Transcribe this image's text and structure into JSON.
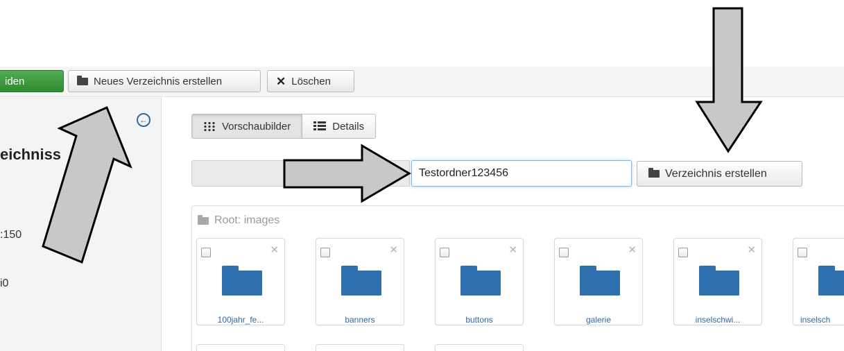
{
  "toolbar": {
    "upload_label": "iden",
    "new_directory_label": "Neues Verzeichnis erstellen",
    "delete_label": "Löschen"
  },
  "sidebar": {
    "title_fragment": "eichniss",
    "line1": ":150",
    "line2": "i0"
  },
  "view_toggle": {
    "thumbnails_label": "Vorschaubilder",
    "details_label": "Details",
    "active": "thumbnails"
  },
  "folder_form": {
    "folder_name_value": "Testordner123456",
    "create_button_label": "Verzeichnis erstellen"
  },
  "browser": {
    "root_label": "Root: images",
    "folders": [
      {
        "name": "100jahr_fe..."
      },
      {
        "name": "banners"
      },
      {
        "name": "buttons"
      },
      {
        "name": "galerie"
      },
      {
        "name": "inselschwi..."
      },
      {
        "name": "inselsch"
      }
    ]
  },
  "colors": {
    "accent_blue": "#2a6aa8",
    "folder_blue": "#2f6fad",
    "upload_green": "#3c9a3c",
    "arrow_fill": "#c8c8c8"
  },
  "icons": [
    "folder-open-icon",
    "close-icon",
    "back-circle-icon",
    "grid-icon",
    "list-icon"
  ]
}
